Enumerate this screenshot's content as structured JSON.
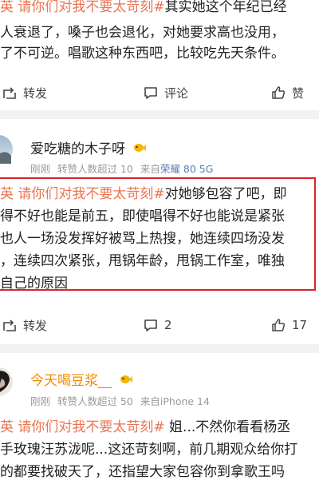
{
  "post1": {
    "lines": [
      {
        "topic": "英 请你们对我不要太苛刻#",
        "text": "其实她这个年纪已经"
      },
      {
        "topic": "",
        "text": "人衰退了，嗓子也会退化，对她要求高也没用，"
      },
      {
        "topic": "",
        "text": "了不可逆。唱歌这种东西吧，比较吃先天条件。"
      }
    ],
    "actions": {
      "repost": "转发",
      "comment": "评论",
      "like": "赞"
    }
  },
  "post2": {
    "username": "爱吃糖的木子呀",
    "meta_time": "刚刚",
    "meta_likes": "转赞人数超过 10",
    "meta_source": "来自",
    "meta_device": "荣耀 80 5G",
    "lines": [
      {
        "topic": "英 请你们对我不要太苛刻#",
        "text": "对她够包容了吧，即"
      },
      {
        "topic": "",
        "text": "得不好也能是前五，即使唱得不好也能说是紧张"
      },
      {
        "topic": "",
        "text": "也人一场没发挥好被骂上热搜，她连续四场没发"
      },
      {
        "topic": "",
        "text": "，连续四次紧张，甩锅年龄，甩锅工作室，唯独"
      },
      {
        "topic": "",
        "text": "自己的原因"
      }
    ],
    "actions": {
      "repost": "转发",
      "comment": "2",
      "like": "17"
    }
  },
  "post3": {
    "username": "今天喝豆浆__",
    "meta_time": "刚刚",
    "meta_likes": "转赞人数超过 50",
    "meta_source": "来自",
    "meta_device": "iPhone 14",
    "lines": [
      {
        "topic": "英 请你们对我不要太苛刻#",
        "text": " 姐...不然你看看杨丞"
      },
      {
        "topic": "",
        "text": "手玫瑰汪苏泷呢...这还苛刻啊，前几期观众给你打"
      },
      {
        "topic": "",
        "text": "的都要找破天了，还指望大家包容你到拿歌王吗"
      }
    ]
  },
  "colors": {
    "topic": "#eb7350",
    "highlight_box": "#d8242b",
    "meta": "#9a9a9a",
    "device": "#5a7fb5"
  }
}
